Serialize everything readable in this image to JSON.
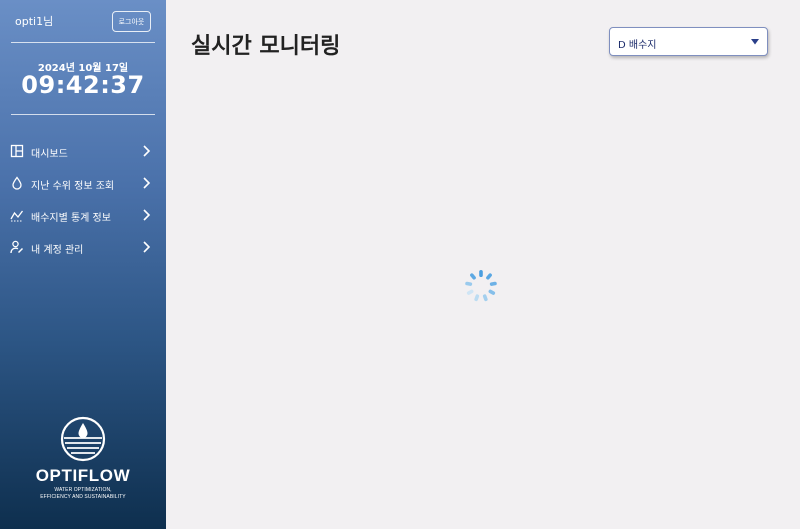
{
  "sidebar": {
    "username": "opti1님",
    "logout_label": "로그아웃",
    "date": "2024년 10월 17일",
    "time": "09:42:37",
    "nav": [
      {
        "label": "대시보드",
        "icon": "dashboard-icon"
      },
      {
        "label": "지난 수위 정보 조회",
        "icon": "water-drop-icon"
      },
      {
        "label": "배수지별 통계 정보",
        "icon": "trend-chart-icon"
      },
      {
        "label": "내 계정 관리",
        "icon": "account-edit-icon"
      }
    ],
    "brand": {
      "name": "OPTIFLOW",
      "tagline_1": "WATER OPTIMIZATION,",
      "tagline_2": "EFFICIENCY AND SUSTAINABILITY"
    }
  },
  "main": {
    "title": "실시간 모니터링",
    "reservoir_select": {
      "value": "D 배수지"
    },
    "loading_indicator": "spinner-icon"
  }
}
